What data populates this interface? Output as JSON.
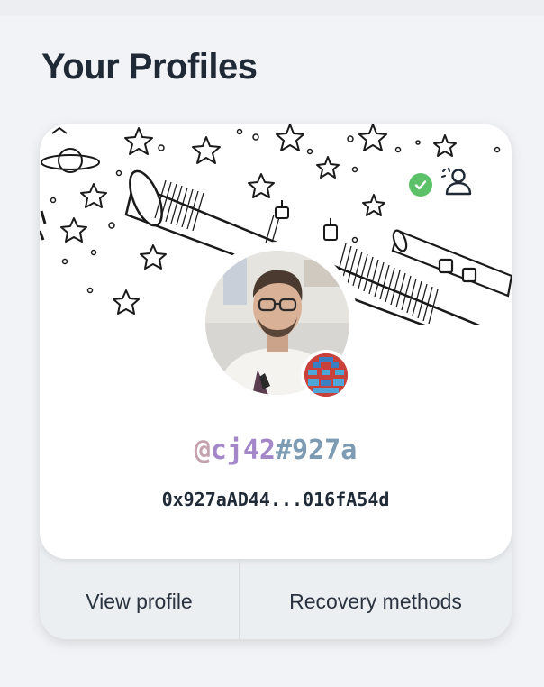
{
  "page": {
    "title": "Your Profiles"
  },
  "profile_card": {
    "handle_at": "@",
    "handle_name": "cj42",
    "handle_tag": "#927a",
    "address": "0x927aAD44...016fA54d",
    "verified_icon": "check-circle-icon",
    "recovery_icon": "user-recovery-icon",
    "banner_image": "telescope-stars-illustration",
    "avatar_image": "person-with-glasses-photo",
    "badge_image": "pixel-art-badge",
    "colors": {
      "handle_at": "#c4a2ae",
      "handle_name": "#a487c9",
      "handle_tag": "#7d9bb2",
      "verified": "#5cc269"
    }
  },
  "actions": {
    "view_profile": "View profile",
    "recovery_methods": "Recovery methods"
  }
}
